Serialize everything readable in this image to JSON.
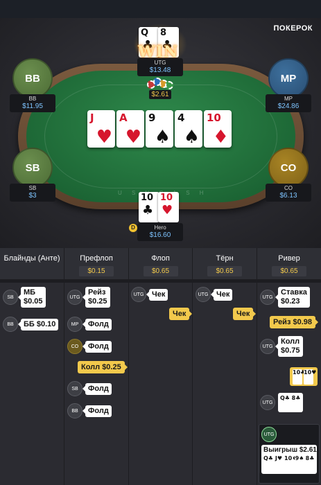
{
  "brand": "ПОКЕРОК",
  "seats": {
    "utg": {
      "name": "UTG",
      "stack": "$13.48",
      "cards": [
        {
          "rank": "Q",
          "suit": "♣"
        },
        {
          "rank": "8",
          "suit": "♣"
        }
      ],
      "badge": "WIN"
    },
    "bb": {
      "avatar": "BB",
      "name": "BB",
      "stack": "$11.95"
    },
    "mp": {
      "avatar": "MP",
      "name": "MP",
      "stack": "$24.86"
    },
    "sb": {
      "avatar": "SB",
      "name": "SB",
      "stack": "$3"
    },
    "co": {
      "avatar": "CO",
      "name": "CO",
      "stack": "$6.13"
    },
    "hero": {
      "name": "Hero",
      "stack": "$16.60",
      "cards": [
        {
          "rank": "10",
          "suit": "♣"
        },
        {
          "rank": "10",
          "suit": "♥"
        }
      ],
      "dealer": "D"
    }
  },
  "pot": "$2.61",
  "board": [
    {
      "rank": "J",
      "suit": "♥",
      "color": "red"
    },
    {
      "rank": "A",
      "suit": "♥",
      "color": "red"
    },
    {
      "rank": "9",
      "suit": "♠",
      "color": "black"
    },
    {
      "rank": "4",
      "suit": "♠",
      "color": "black"
    },
    {
      "rank": "10",
      "suit": "♦",
      "color": "red"
    }
  ],
  "rim_text": "U S H C A S H",
  "history": {
    "columns": [
      {
        "title": "Блайнды (Анте)",
        "value": ""
      },
      {
        "title": "Префлоп",
        "value": "$0.15"
      },
      {
        "title": "Флоп",
        "value": "$0.65"
      },
      {
        "title": "Тёрн",
        "value": "$0.65"
      },
      {
        "title": "Ривер",
        "value": "$0.65"
      }
    ],
    "blinds": [
      {
        "pos": "SB",
        "action": "МБ",
        "amount": "$0.05"
      },
      {
        "pos": "BB",
        "action": "ББ $0.10"
      }
    ],
    "preflop": [
      {
        "pos": "UTG",
        "action": "Рейз",
        "amount": "$0.25"
      },
      {
        "pos": "MP",
        "action": "Фолд"
      },
      {
        "pos": "CO",
        "action": "Фолд"
      },
      {
        "hero": "Колл $0.25"
      },
      {
        "pos": "SB",
        "action": "Фолд"
      },
      {
        "pos": "BB",
        "action": "Фолд"
      }
    ],
    "flop": [
      {
        "pos": "UTG",
        "action": "Чек"
      },
      {
        "hero": "Чек"
      }
    ],
    "turn": [
      {
        "pos": "UTG",
        "action": "Чек"
      },
      {
        "hero": "Чек"
      }
    ],
    "river": [
      {
        "pos": "UTG",
        "action": "Ставка",
        "amount": "$0.23"
      },
      {
        "hero": "Рейз $0.98"
      },
      {
        "pos": "UTG",
        "action": "Колл",
        "amount": "$0.75"
      },
      {
        "hero_cards": [
          "10♣",
          "10♥"
        ]
      },
      {
        "pos": "UTG",
        "cards": [
          "Q♣",
          "8♣"
        ]
      }
    ],
    "result": {
      "pos": "UTG",
      "label": "Выигрыш $2.61",
      "cards": [
        "Q♣",
        "J♥",
        "10♦",
        "9♠",
        "8♣"
      ]
    }
  }
}
